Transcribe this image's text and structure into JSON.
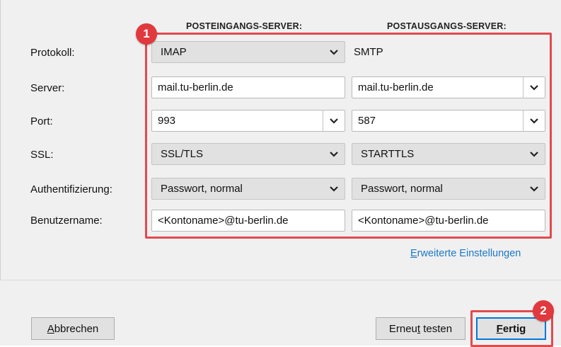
{
  "columns": {
    "incoming": "POSTEINGANGS-SERVER:",
    "outgoing": "POSTAUSGANGS-SERVER:"
  },
  "labels": {
    "protocol": "Protokoll:",
    "server": "Server:",
    "port": "Port:",
    "ssl": "SSL:",
    "auth": "Authentifizierung:",
    "username": "Benutzername:"
  },
  "incoming": {
    "protocol": "IMAP",
    "server": "mail.tu-berlin.de",
    "port": "993",
    "ssl": "SSL/TLS",
    "auth": "Passwort, normal",
    "username": "<Kontoname>@tu-berlin.de"
  },
  "outgoing": {
    "protocol": "SMTP",
    "server": "mail.tu-berlin.de",
    "port": "587",
    "ssl": "STARTTLS",
    "auth": "Passwort, normal",
    "username": "<Kontoname>@tu-berlin.de"
  },
  "advanced_link": {
    "first": "E",
    "rest": "rweiterte Einstellungen"
  },
  "buttons": {
    "cancel": {
      "first": "A",
      "rest": "bbrechen"
    },
    "retest": {
      "pre": "Erneu",
      "acc": "t",
      "post": " testen"
    },
    "done": {
      "first": "F",
      "rest": "ertig"
    }
  },
  "badges": {
    "one": "1",
    "two": "2"
  },
  "colors": {
    "highlight": "#e24a4f",
    "badge": "#e0393e",
    "link": "#1c78c8"
  },
  "icons": {
    "dropdown": "chevron-down-icon"
  }
}
